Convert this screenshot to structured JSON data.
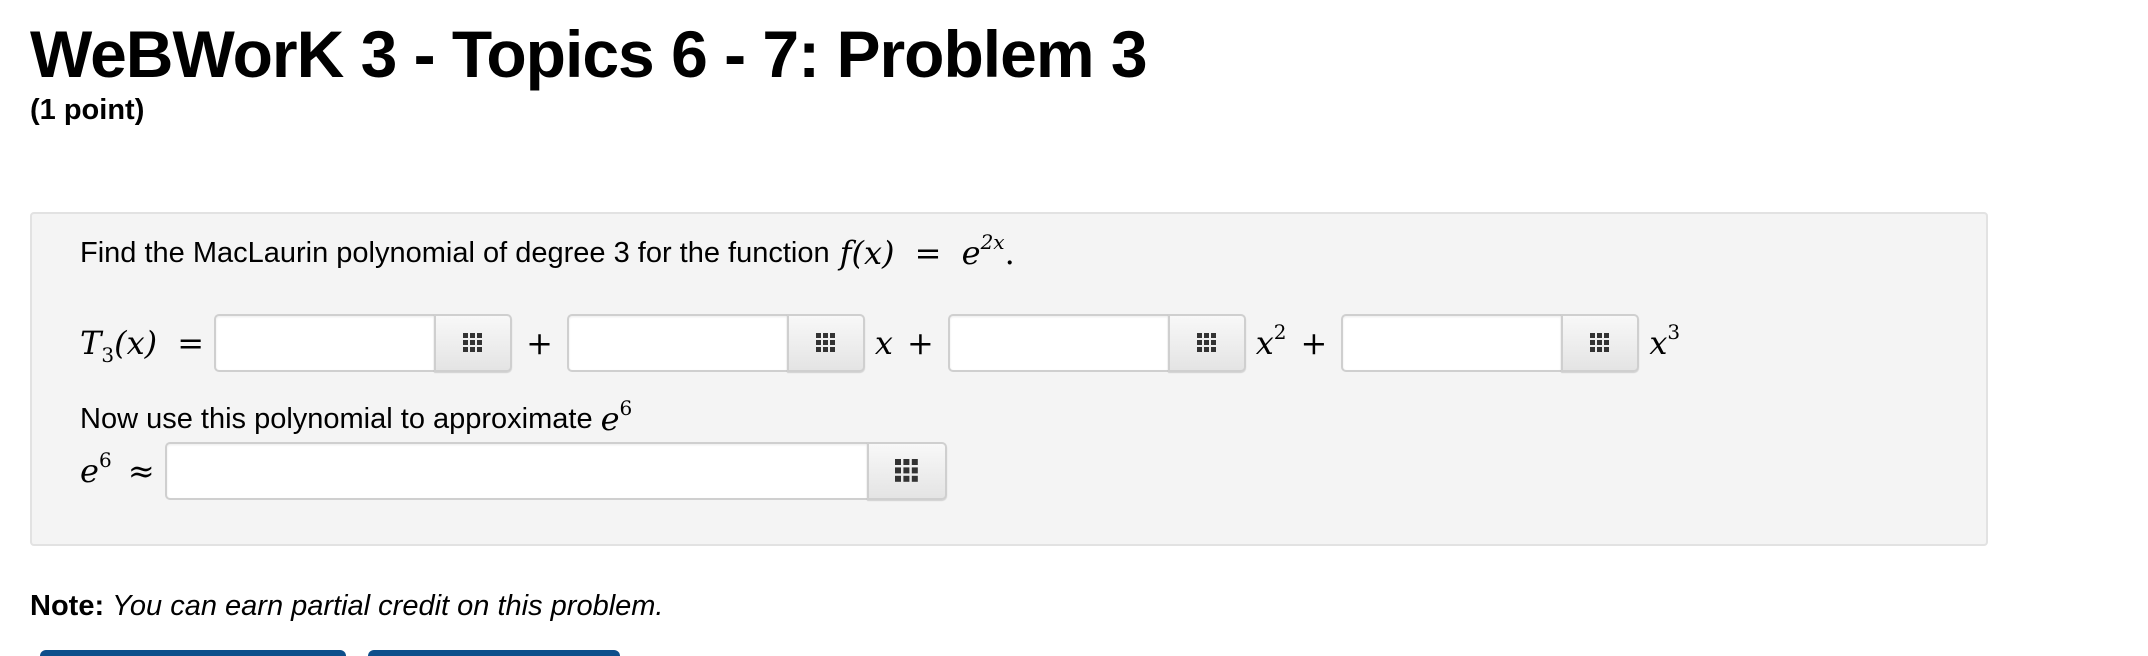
{
  "header": {
    "title": "WeBWorK 3 - Topics 6 - 7: Problem 3",
    "points": "(1 point)"
  },
  "problem": {
    "prompt_text": "Find the MacLaurin polynomial of degree 3 for the function",
    "function_lhs": "f(x)",
    "equals": "=",
    "function_base": "e",
    "function_exponent": "2x",
    "period": ".",
    "polynomial_label": "T",
    "polynomial_subscript": "3",
    "polynomial_arg": "(x)",
    "plus": "+",
    "term_x": "x",
    "term_x2_base": "x",
    "term_x2_exp": "2",
    "term_x3_base": "x",
    "term_x3_exp": "3",
    "answers": [
      {
        "value": "",
        "placeholder": ""
      },
      {
        "value": "",
        "placeholder": ""
      },
      {
        "value": "",
        "placeholder": ""
      },
      {
        "value": "",
        "placeholder": ""
      }
    ],
    "approx_prompt": "Now use this polynomial to approximate",
    "approx_base": "e",
    "approx_exp": "6",
    "approx_symbol": "≈",
    "approx_answer": {
      "value": "",
      "placeholder": ""
    }
  },
  "note": {
    "label": "Note:",
    "text": "You can earn partial credit on this problem."
  },
  "icons": {
    "equation_editor": "grid-icon"
  },
  "colors": {
    "box_background": "#f4f4f4",
    "button_blue": "#0d4f8b"
  }
}
